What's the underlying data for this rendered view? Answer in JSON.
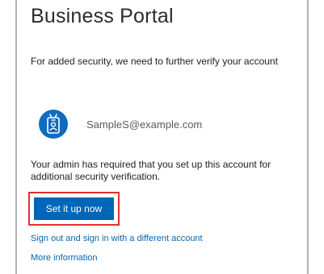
{
  "page": {
    "title": "Business Portal",
    "subtitle": "For added security, we need to further verify your account"
  },
  "account": {
    "email": "SampleS@example.com",
    "avatar_icon": "badge-id-icon",
    "avatar_color": "#0f6cbd"
  },
  "notice": {
    "text": "Your admin has required that you set up this account for additional security verification."
  },
  "actions": {
    "setup_label": "Set it up now",
    "setup_color": "#0067b8",
    "highlight_color": "#e03030",
    "signout_label": "Sign out and sign in with a different account",
    "more_info_label": "More information"
  }
}
